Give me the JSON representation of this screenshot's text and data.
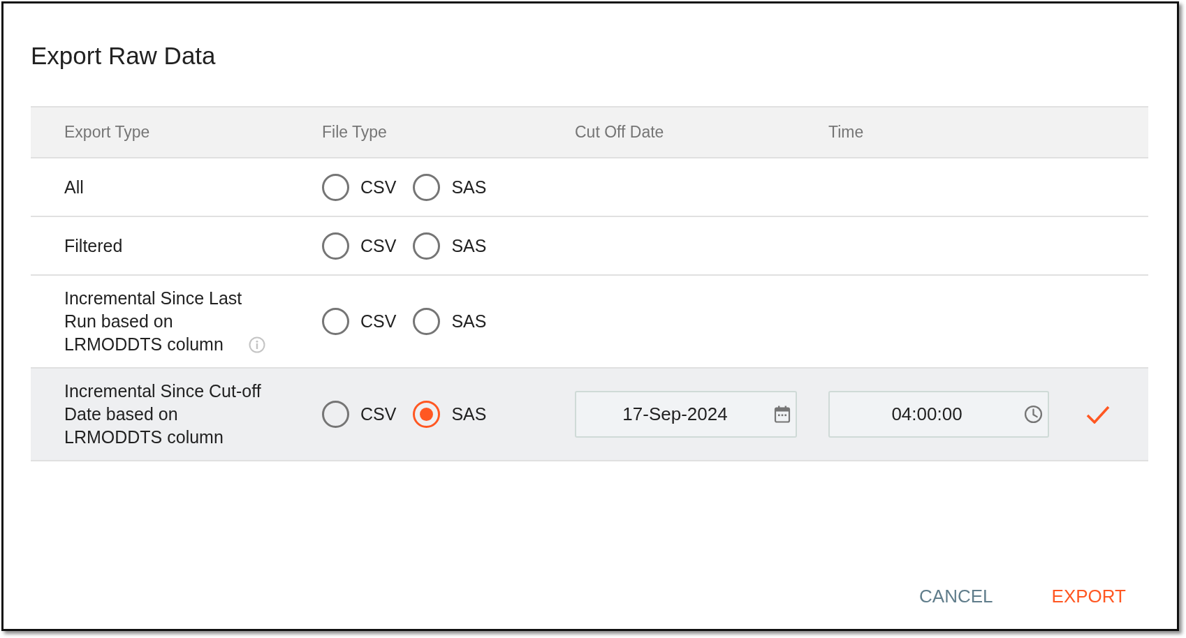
{
  "dialog": {
    "title": "Export Raw Data",
    "table": {
      "columns": [
        "Export Type",
        "File Type",
        "Cut Off Date",
        "Time"
      ],
      "rows": [
        {
          "export_type": "All",
          "info": false,
          "selected": false,
          "confirmed": false,
          "file_types": [
            {
              "label": "CSV",
              "selected": false
            },
            {
              "label": "SAS",
              "selected": false
            }
          ]
        },
        {
          "export_type": "Filtered",
          "info": false,
          "selected": false,
          "confirmed": false,
          "file_types": [
            {
              "label": "CSV",
              "selected": false
            },
            {
              "label": "SAS",
              "selected": false
            }
          ]
        },
        {
          "export_type": "Incremental Since Last Run based on LRMODDTS column",
          "info": true,
          "selected": false,
          "confirmed": false,
          "file_types": [
            {
              "label": "CSV",
              "selected": false
            },
            {
              "label": "SAS",
              "selected": false
            }
          ]
        },
        {
          "export_type": "Incremental Since Cut-off Date based on LRMODDTS column",
          "info": false,
          "selected": true,
          "confirmed": true,
          "file_types": [
            {
              "label": "CSV",
              "selected": false
            },
            {
              "label": "SAS",
              "selected": true
            }
          ],
          "cut_off_date": {
            "value": "17-Sep-2024"
          },
          "time": {
            "value": "04:00:00"
          }
        }
      ]
    },
    "buttons": [
      {
        "label": "CANCEL",
        "kind": "secondary"
      },
      {
        "label": "EXPORT",
        "kind": "primary"
      }
    ]
  }
}
